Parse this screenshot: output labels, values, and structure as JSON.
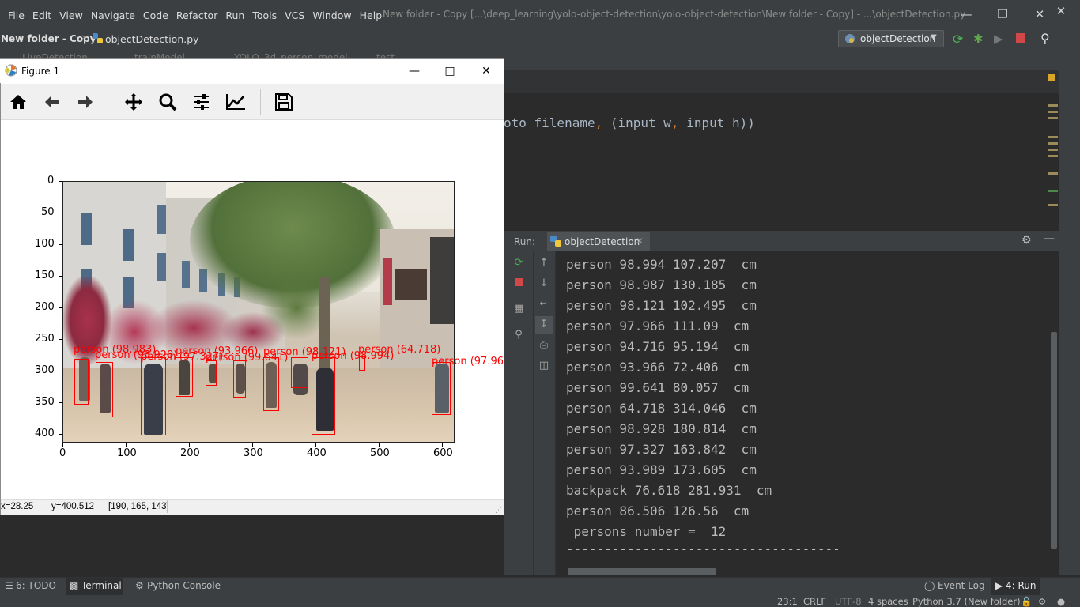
{
  "menu": [
    "File",
    "Edit",
    "View",
    "Navigate",
    "Code",
    "Refactor",
    "Run",
    "Tools",
    "VCS",
    "Window",
    "Help"
  ],
  "window_title": "New folder - Copy [...\\deep_learning\\yolo-object-detection\\yolo-object-detection\\New folder - Copy] - ...\\objectDetection.py",
  "breadcrumb": {
    "project": "New folder - Copy",
    "file": "objectDetection.py"
  },
  "run_config": "objectDetection",
  "ghost_tabs": [
    "LiveDetection",
    "trainModel",
    "YOLO_3d_person_model",
    "test"
  ],
  "editor": {
    "code_prefix": "oto_filename",
    "code_mid": " (input_w",
    "code_tail": " input_h))",
    "comma": ","
  },
  "run_panel": {
    "label": "Run:",
    "tab": "objectDetection"
  },
  "console_lines": [
    "person 98.994 107.207  cm",
    "person 98.987 130.185  cm",
    "person 98.121 102.495  cm",
    "person 97.966 111.09  cm",
    "person 94.716 95.194  cm",
    "person 93.966 72.406  cm",
    "person 99.641 80.057  cm",
    "person 64.718 314.046  cm",
    "person 98.928 180.814  cm",
    "person 97.327 163.842  cm",
    "person 93.989 173.605  cm",
    "backpack 76.618 281.931  cm",
    "person 86.506 126.56  cm",
    " persons number =  12",
    "------------------------------------"
  ],
  "bottom_tools": {
    "todo": "6: TODO",
    "terminal": "Terminal",
    "python_console": "Python Console",
    "event_log": "Event Log",
    "run": "4: Run"
  },
  "status": {
    "position": "23:1",
    "line_sep": "CRLF",
    "encoding": "UTF-8",
    "indent": "4 spaces",
    "interpreter": "Python 3.7 (New folder)"
  },
  "figure": {
    "title": "Figure 1",
    "toolbar": [
      "home-icon",
      "back-icon",
      "forward-icon",
      "pan-icon",
      "zoom-icon",
      "configure-subplots-icon",
      "edit-axis-icon",
      "save-icon"
    ],
    "status": {
      "x": "x=28.25",
      "y": "y=400.512",
      "rgb": "[190, 165, 143]"
    },
    "y_ticks": [
      "0",
      "50",
      "100",
      "150",
      "200",
      "250",
      "300",
      "350",
      "400"
    ],
    "x_ticks": [
      "0",
      "100",
      "200",
      "300",
      "400",
      "500",
      "600"
    ],
    "detection_labels": [
      "person (98.983)",
      "person (98.928)",
      "person (97.327)",
      "person (93.966)",
      "person (99.641)",
      "person (98.121)",
      "person (98.994)",
      "person (64.718)",
      "person (97.96"
    ]
  },
  "colors": {
    "ide_bg": "#2b2b2b",
    "chrome": "#3c3f41",
    "box": "#ff0000",
    "keyword": "#cc7832"
  }
}
